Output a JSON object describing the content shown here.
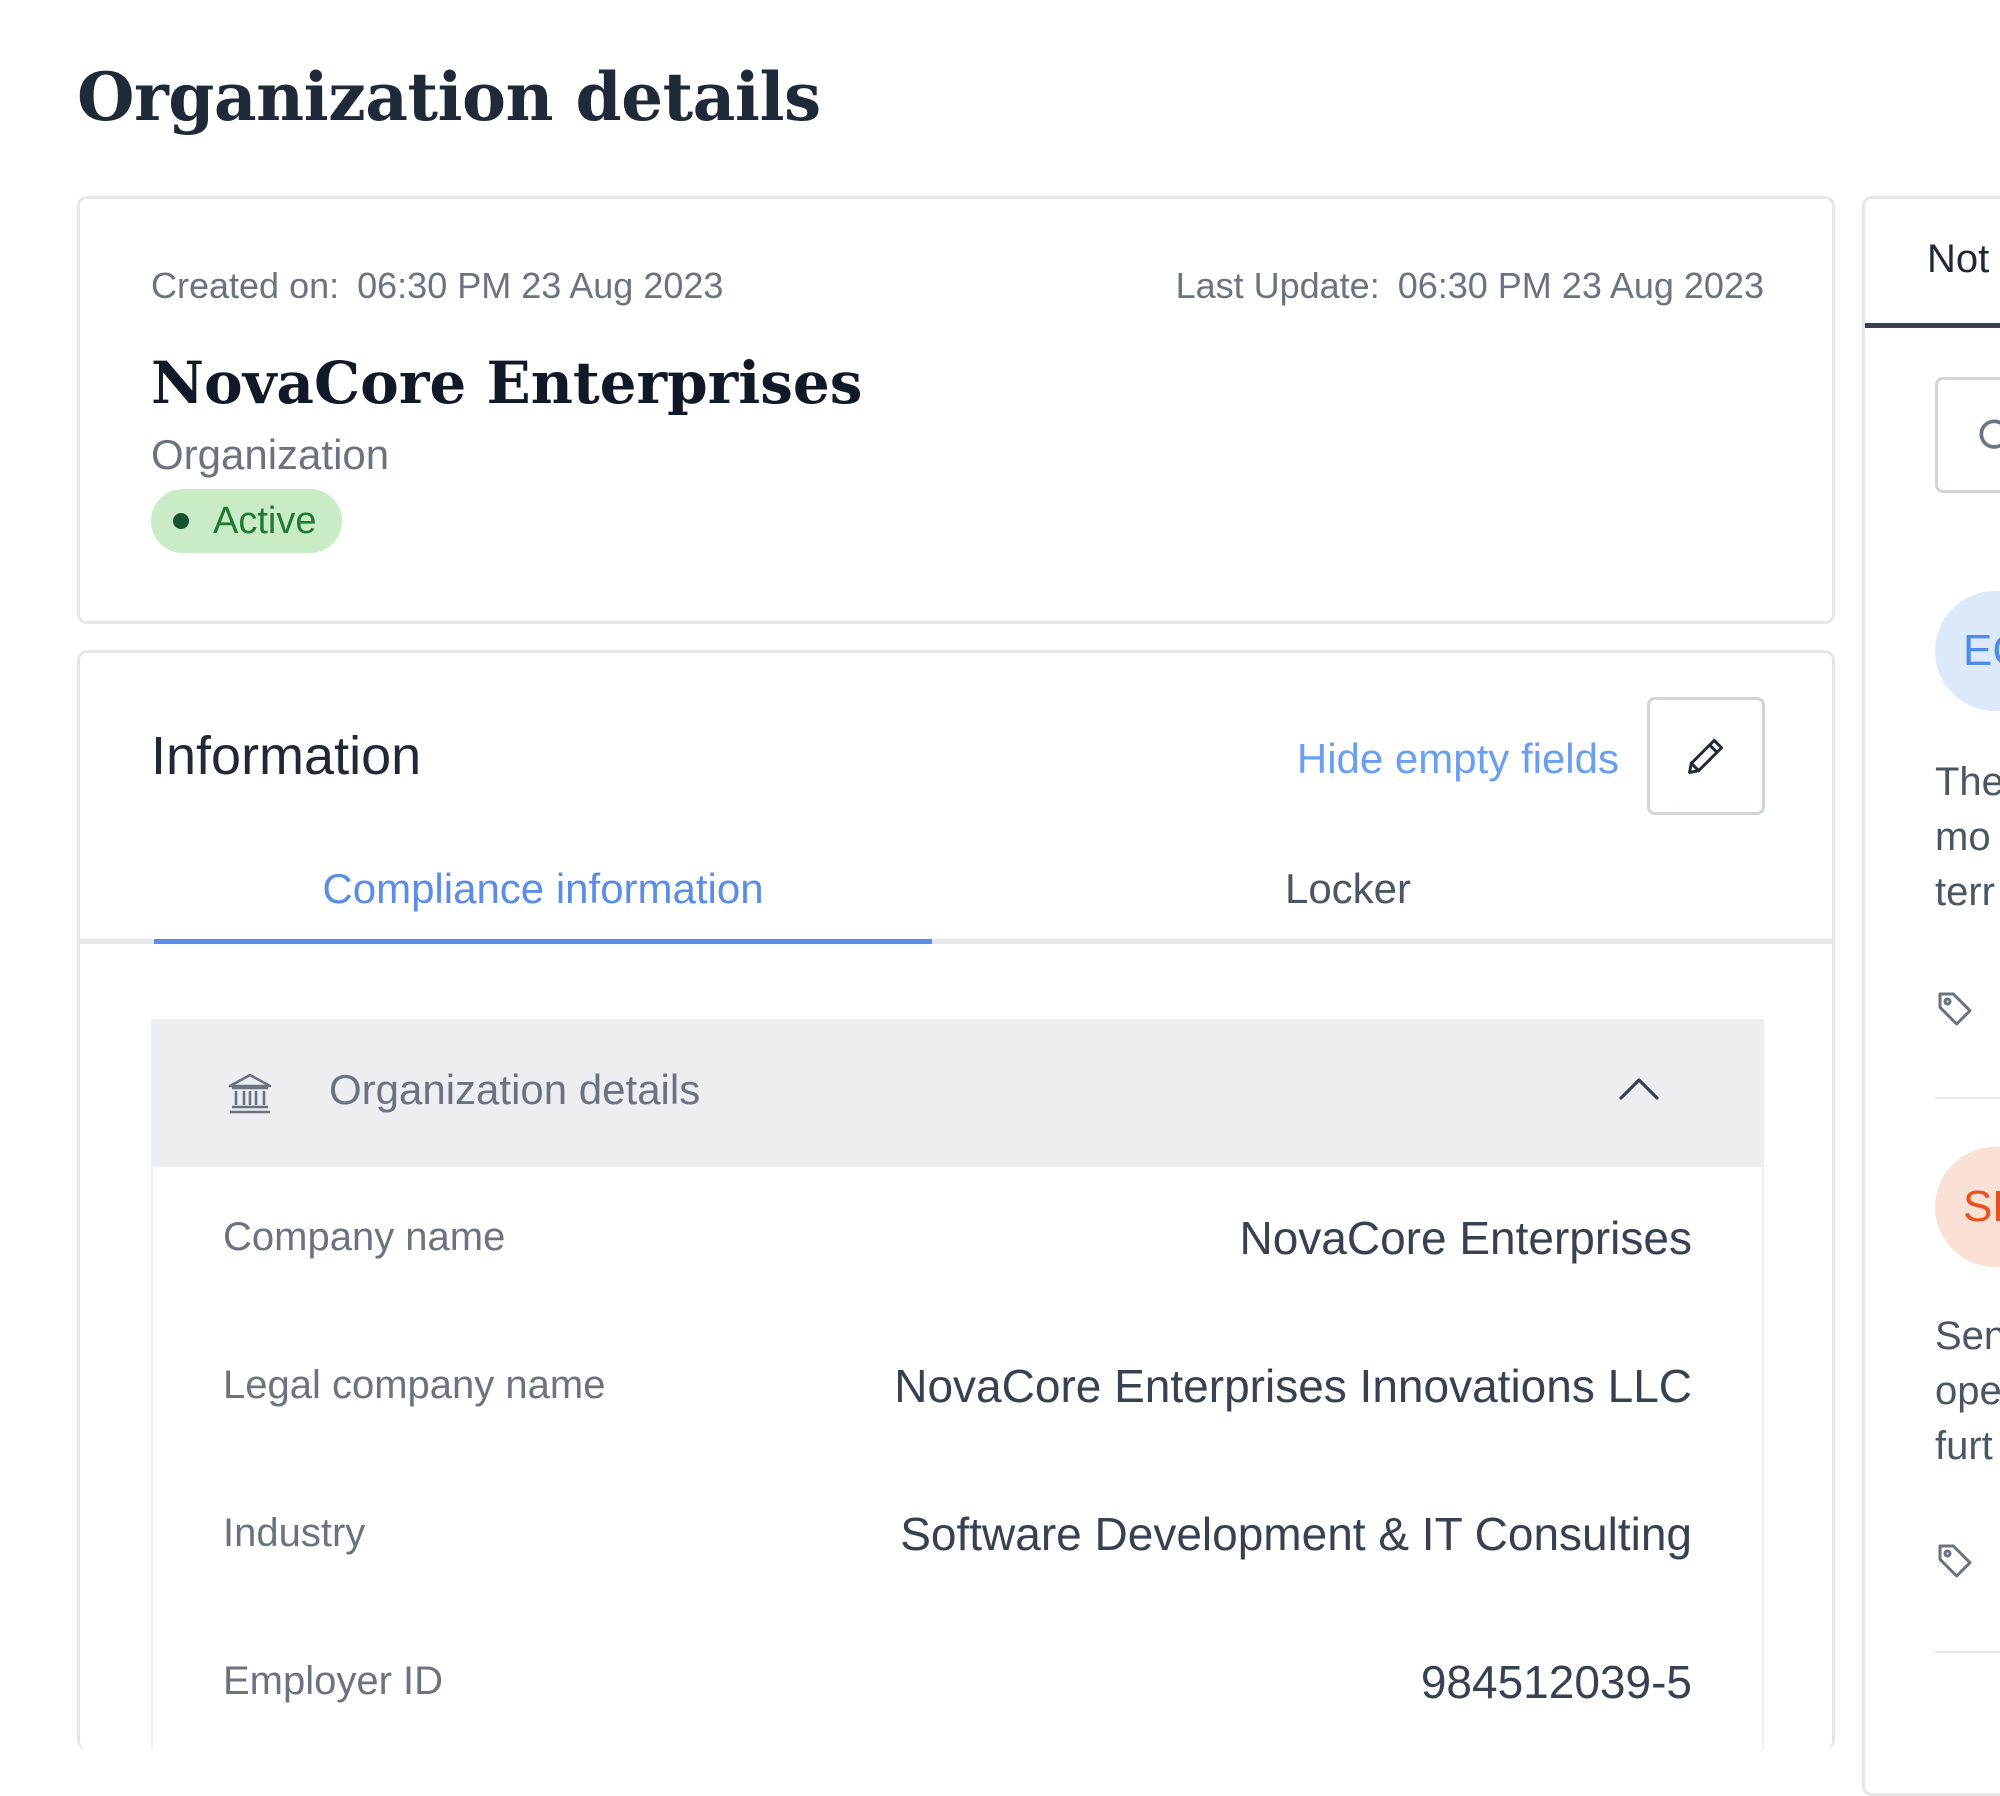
{
  "page": {
    "title": "Organization details"
  },
  "header": {
    "created_label": "Created on:",
    "created_value": "06:30 PM 23 Aug 2023",
    "updated_label": "Last Update:",
    "updated_value": "06:30 PM 23 Aug 2023",
    "org_name": "NovaCore Enterprises",
    "org_type": "Organization",
    "status": "Active"
  },
  "information": {
    "title": "Information",
    "hide_empty_label": "Hide empty fields",
    "edit_icon": "pencil-icon",
    "tabs": [
      {
        "label": "Compliance information",
        "active": true
      },
      {
        "label": "Locker",
        "active": false
      }
    ],
    "section": {
      "title": "Organization details",
      "icon": "bank-icon",
      "expanded": true,
      "rows": [
        {
          "label": "Company name",
          "value": "NovaCore Enterprises"
        },
        {
          "label": "Legal company name",
          "value": "NovaCore Enterprises Innovations LLC"
        },
        {
          "label": "Industry",
          "value": "Software Development & IT Consulting"
        },
        {
          "label": "Employer ID",
          "value": "984512039-5"
        }
      ]
    }
  },
  "notes_panel": {
    "tab_label": "Not",
    "notes": [
      {
        "avatar": "EC",
        "text": "The\nmo\nterr"
      },
      {
        "avatar": "SH",
        "text": "Sen\nope\nfurt"
      }
    ]
  },
  "colors": {
    "accent": "#5b8ce6",
    "status_bg": "#c9ebc6",
    "status_text": "#1e7a34",
    "section_bg": "#eceef1"
  }
}
